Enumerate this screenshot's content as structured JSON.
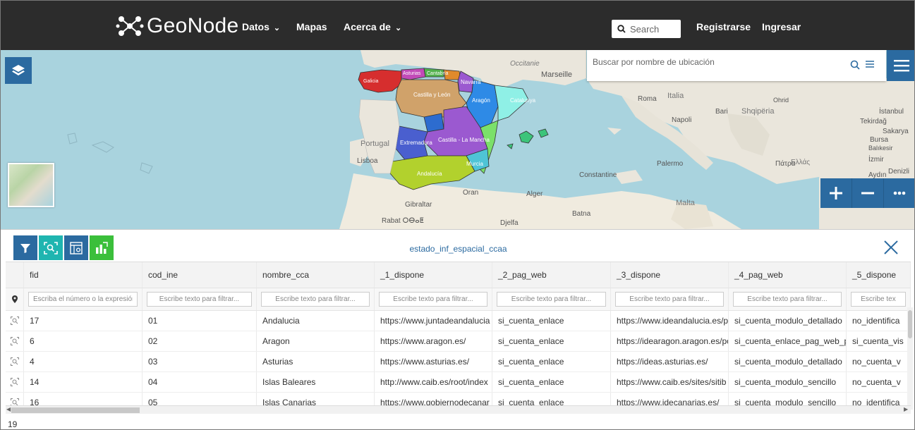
{
  "navbar": {
    "brand": "GeoNode",
    "menu": [
      {
        "label": "Datos",
        "dropdown": true
      },
      {
        "label": "Mapas",
        "dropdown": false
      },
      {
        "label": "Acerca de",
        "dropdown": true
      }
    ],
    "search_placeholder": "Search",
    "register": "Registrarse",
    "login": "Ingresar",
    "colors": {
      "background": "#2c2c2c",
      "accent": "#2b6aa0"
    }
  },
  "map": {
    "search_placeholder": "Buscar por nombre de ubicación",
    "labels": [
      "Occitanie",
      "Marseille",
      "Roma",
      "Italia",
      "Napoli",
      "Bari",
      "Palermo",
      "Malta",
      "Shqipëria",
      "Ελλάς",
      "Πάτρα",
      "Ohrid",
      "Bursa",
      "Balıkesir",
      "İzmir",
      "Aydın",
      "Denizli",
      "Sakarya",
      "Tekirdağ",
      "İstanbul",
      "Portugal",
      "Lisboa",
      "Gibraltar",
      "Rabat ⵔⴱⴰⵟ",
      "Oran",
      "Alger",
      "Constantine",
      "Batna",
      "Djelfa",
      "Catalunya",
      "Navarra",
      "Castilla y León",
      "Aragón",
      "Castilla - La Mancha",
      "Extremadura",
      "Murcia",
      "Andalucía",
      "Galicia",
      "Cantabria",
      "Asturias"
    ],
    "region_colors": {
      "Galicia": "#d62e2e",
      "Asturias": "#c24bb8",
      "Cantabria": "#53b14e",
      "Pais Vasco": "#e08a2c",
      "Navarra": "#9b59d0",
      "Castilla y Leon": "#d0a26a",
      "Aragon": "#2e8ae6",
      "Catalunya": "#8ff0e6",
      "Madrid": "#2d6ccf",
      "Castilla La Mancha": "#9b59d0",
      "Extremadura": "#4a5fcf",
      "Valencia": "#7be06a",
      "Murcia": "#4fc4d6",
      "Andalucia": "#b2d12d",
      "Baleares": "#3cc47a"
    }
  },
  "table": {
    "title": "estado_inf_espacial_ccaa",
    "columns": [
      "fid",
      "cod_ine",
      "nombre_cca",
      "_1_dispone",
      "_2_pag_web",
      "_3_dispone",
      "_4_pag_web",
      "_5_dispone"
    ],
    "filter_placeholders": [
      "Escriba el número o la expresión",
      "Escribe texto para filtrar...",
      "Escribe texto para filtrar...",
      "Escribe texto para filtrar...",
      "Escribe texto para filtrar...",
      "Escribe texto para filtrar...",
      "Escribe texto para filtrar...",
      "Escribe tex"
    ],
    "rows": [
      [
        "17",
        "01",
        "Andalucia",
        "https://www.juntadeandalucia",
        "si_cuenta_enlace",
        "https://www.ideandalucia.es/p",
        "si_cuenta_modulo_detallado",
        "no_identifica"
      ],
      [
        "6",
        "02",
        "Aragon",
        "https://www.aragon.es/",
        "si_cuenta_enlace",
        "https://idearagon.aragon.es/po",
        "si_cuenta_enlace_pag_web_pla",
        "si_cuenta_vis"
      ],
      [
        "4",
        "03",
        "Asturias",
        "https://www.asturias.es/",
        "si_cuenta_enlace",
        "https://ideas.asturias.es/",
        "si_cuenta_modulo_detallado",
        "no_cuenta_v"
      ],
      [
        "14",
        "04",
        "Islas Baleares",
        "http://www.caib.es/root/index",
        "si_cuenta_enlace",
        "https://www.caib.es/sites/sitib",
        "si_cuenta_modulo_sencillo",
        "no_cuenta_v"
      ],
      [
        "16",
        "05",
        "Islas Canarias",
        "https://www.gobiernodecanar",
        "si_cuenta_enlace",
        "https://www.idecanarias.es/",
        "si_cuenta_modulo_sencillo",
        "no_identifica"
      ]
    ],
    "count": "19"
  }
}
